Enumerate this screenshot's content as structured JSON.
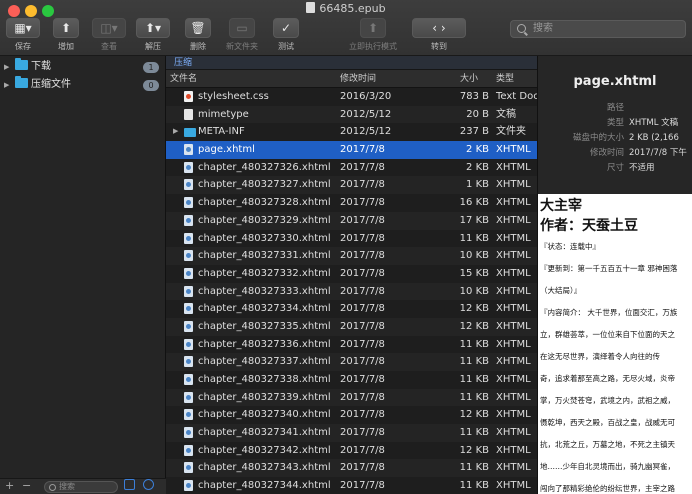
{
  "window": {
    "title": "66485.epub"
  },
  "toolbar": {
    "buttons": [
      {
        "label": "保存",
        "icon": "save-icon",
        "glyph": "▦▾",
        "disabled": false
      },
      {
        "label": "增加",
        "icon": "add-icon",
        "glyph": "⬆",
        "disabled": false
      },
      {
        "label": "查看",
        "icon": "view-icon",
        "glyph": "◫▾",
        "disabled": true
      },
      {
        "label": "解压",
        "icon": "extract-icon",
        "glyph": "⬆▾",
        "disabled": false
      },
      {
        "label": "删除",
        "icon": "trash-icon",
        "glyph": "🗑",
        "disabled": false
      },
      {
        "label": "新文件夹",
        "icon": "new-folder-icon",
        "glyph": "▭",
        "disabled": true
      },
      {
        "label": "测试",
        "icon": "test-icon",
        "glyph": "✓",
        "disabled": false
      },
      {
        "label": "立即执行模式",
        "icon": "run-now-icon",
        "glyph": "⬆",
        "disabled": true
      },
      {
        "label": "转到",
        "icon": "nav-arrows-icon",
        "glyph": "‹   ›",
        "disabled": false
      }
    ],
    "search_placeholder": "搜索"
  },
  "sidebar": {
    "items": [
      {
        "label": "下载",
        "badge": "1",
        "icon": "folder-icon"
      },
      {
        "label": "压缩文件",
        "badge": "0",
        "icon": "folder-icon"
      }
    ],
    "footer": {
      "add": "+",
      "remove": "−",
      "search_placeholder": "搜索"
    }
  },
  "breadcrumb": "压缩",
  "columns": {
    "name": "文件名",
    "modified": "修改时间",
    "size": "大小",
    "type": "类型"
  },
  "files": [
    {
      "name": "stylesheet.css",
      "modified": "2016/3/20",
      "size": "783 B",
      "type": "Text Doc",
      "kind": "css",
      "selected": false
    },
    {
      "name": "mimetype",
      "modified": "2012/5/12",
      "size": "20 B",
      "type": "文稿",
      "kind": "plain",
      "selected": false
    },
    {
      "name": "META-INF",
      "modified": "2012/5/12",
      "size": "237 B",
      "type": "文件夹",
      "kind": "folder",
      "selected": false
    },
    {
      "name": "page.xhtml",
      "modified": "2017/7/8",
      "size": "2 KB",
      "type": "XHTML",
      "kind": "xhtml",
      "selected": true
    },
    {
      "name": "chapter_480327326.xhtml",
      "modified": "2017/7/8",
      "size": "2 KB",
      "type": "XHTML",
      "kind": "xhtml",
      "selected": false
    },
    {
      "name": "chapter_480327327.xhtml",
      "modified": "2017/7/8",
      "size": "1 KB",
      "type": "XHTML",
      "kind": "xhtml",
      "selected": false
    },
    {
      "name": "chapter_480327328.xhtml",
      "modified": "2017/7/8",
      "size": "16 KB",
      "type": "XHTML",
      "kind": "xhtml",
      "selected": false
    },
    {
      "name": "chapter_480327329.xhtml",
      "modified": "2017/7/8",
      "size": "17 KB",
      "type": "XHTML",
      "kind": "xhtml",
      "selected": false
    },
    {
      "name": "chapter_480327330.xhtml",
      "modified": "2017/7/8",
      "size": "11 KB",
      "type": "XHTML",
      "kind": "xhtml",
      "selected": false
    },
    {
      "name": "chapter_480327331.xhtml",
      "modified": "2017/7/8",
      "size": "10 KB",
      "type": "XHTML",
      "kind": "xhtml",
      "selected": false
    },
    {
      "name": "chapter_480327332.xhtml",
      "modified": "2017/7/8",
      "size": "15 KB",
      "type": "XHTML",
      "kind": "xhtml",
      "selected": false
    },
    {
      "name": "chapter_480327333.xhtml",
      "modified": "2017/7/8",
      "size": "10 KB",
      "type": "XHTML",
      "kind": "xhtml",
      "selected": false
    },
    {
      "name": "chapter_480327334.xhtml",
      "modified": "2017/7/8",
      "size": "12 KB",
      "type": "XHTML",
      "kind": "xhtml",
      "selected": false
    },
    {
      "name": "chapter_480327335.xhtml",
      "modified": "2017/7/8",
      "size": "12 KB",
      "type": "XHTML",
      "kind": "xhtml",
      "selected": false
    },
    {
      "name": "chapter_480327336.xhtml",
      "modified": "2017/7/8",
      "size": "11 KB",
      "type": "XHTML",
      "kind": "xhtml",
      "selected": false
    },
    {
      "name": "chapter_480327337.xhtml",
      "modified": "2017/7/8",
      "size": "11 KB",
      "type": "XHTML",
      "kind": "xhtml",
      "selected": false
    },
    {
      "name": "chapter_480327338.xhtml",
      "modified": "2017/7/8",
      "size": "11 KB",
      "type": "XHTML",
      "kind": "xhtml",
      "selected": false
    },
    {
      "name": "chapter_480327339.xhtml",
      "modified": "2017/7/8",
      "size": "11 KB",
      "type": "XHTML",
      "kind": "xhtml",
      "selected": false
    },
    {
      "name": "chapter_480327340.xhtml",
      "modified": "2017/7/8",
      "size": "12 KB",
      "type": "XHTML",
      "kind": "xhtml",
      "selected": false
    },
    {
      "name": "chapter_480327341.xhtml",
      "modified": "2017/7/8",
      "size": "11 KB",
      "type": "XHTML",
      "kind": "xhtml",
      "selected": false
    },
    {
      "name": "chapter_480327342.xhtml",
      "modified": "2017/7/8",
      "size": "12 KB",
      "type": "XHTML",
      "kind": "xhtml",
      "selected": false
    },
    {
      "name": "chapter_480327343.xhtml",
      "modified": "2017/7/8",
      "size": "11 KB",
      "type": "XHTML",
      "kind": "xhtml",
      "selected": false
    },
    {
      "name": "chapter_480327344.xhtml",
      "modified": "2017/7/8",
      "size": "11 KB",
      "type": "XHTML",
      "kind": "xhtml",
      "selected": false
    }
  ],
  "preview": {
    "title": "page.xhtml",
    "info": [
      {
        "key": "路径",
        "value": ""
      },
      {
        "key": "类型",
        "value": "XHTML 文稿"
      },
      {
        "key": "磁盘中的大小",
        "value": "2 KB (2,166"
      },
      {
        "key": "修改时间",
        "value": "2017/7/8 下午"
      },
      {
        "key": "尺寸",
        "value": "不适用"
      }
    ],
    "document": {
      "heading1": "大主宰",
      "heading2": "作者：天蚕土豆",
      "lines": [
        "『状态：连载中』",
        "『更新到：第一千五百五十一章 邪神困落",
        "（大结局）』",
        "『内容简介： 大千世界，位面交汇，万族",
        "立，群雄荟萃，一位位来自下位面的天之",
        "在这无尽世界，演绎着令人向往的传",
        "奇，追求着那至高之路，无尽火域，炎帝",
        "掌，万火焚苍穹，武境之内，武祖之威，",
        "慑乾坤，西天之殿，百战之皇，战威无可",
        "抗，北荒之丘，万墓之地，不死之主镇天",
        "地……少年自北灵境而出，骑九幽冥雀，",
        "闯向了那精彩绝伦的纷纭世界，主宰之路"
      ]
    }
  },
  "colors": {
    "selection": "#1f5fc5",
    "folder": "#39a9e0"
  }
}
